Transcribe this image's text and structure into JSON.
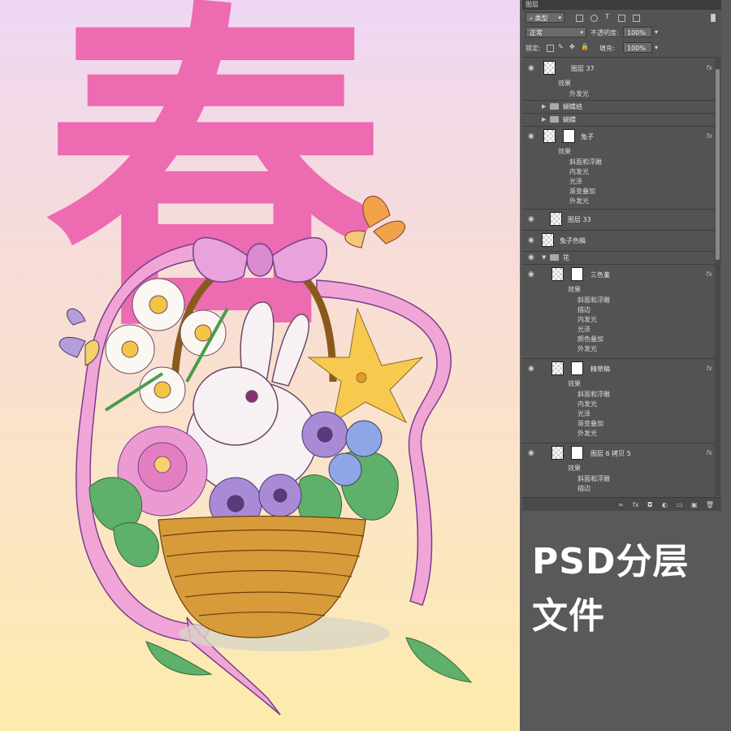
{
  "artwork": {
    "title_char": "春",
    "background_top": "#eed7f3",
    "background_bottom": "#fcebac",
    "accent": "#ec6bb1"
  },
  "panel": {
    "tab_label": "图层",
    "filter_kind": "类型",
    "blend_mode": "正常",
    "opacity_label": "不透明度:",
    "opacity_value": "100%",
    "lock_label": "锁定:",
    "fill_label": "填充:",
    "fill_value": "100%",
    "fx_label": "fx",
    "layers": [
      {
        "name": "图层 37",
        "effects_label": "效果",
        "effects": [
          "外发光"
        ]
      },
      {
        "name": "蝴蝶结",
        "type": "group"
      },
      {
        "name": "蝴蝶",
        "type": "group"
      },
      {
        "name": "兔子",
        "effects_label": "效果",
        "effects": [
          "斜面和浮雕",
          "内发光",
          "光泽",
          "渐变叠加",
          "外发光"
        ]
      },
      {
        "name": "图层 33"
      },
      {
        "name": "兔子色稿"
      },
      {
        "name": "花",
        "type": "group"
      },
      {
        "name": "三色堇",
        "effects_label": "效果",
        "effects": [
          "斜面和浮雕",
          "描边",
          "内发光",
          "光泽",
          "颜色叠加",
          "外发光"
        ]
      },
      {
        "name": "精草稿",
        "effects_label": "效果",
        "effects": [
          "斜面和浮雕",
          "内发光",
          "光泽",
          "渐变叠加",
          "外发光"
        ]
      },
      {
        "name": "图层 6 拷贝 5",
        "effects_label": "效果",
        "effects": [
          "斜面和浮雕",
          "描边"
        ]
      }
    ]
  },
  "promo": {
    "line1": "PSD分层",
    "line2": "文件"
  }
}
